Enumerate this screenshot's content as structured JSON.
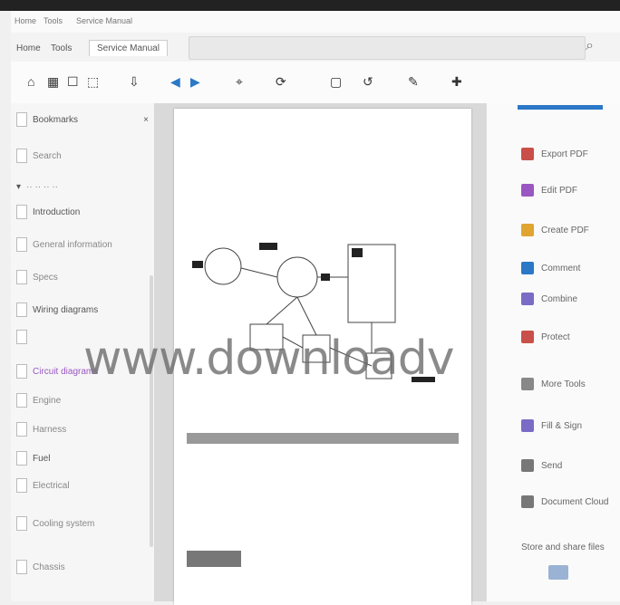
{
  "titlebar": {
    "items": [
      "Home",
      "Tools",
      "Service Manual"
    ],
    "search_placeholder": ""
  },
  "toolbar": {
    "buttons": [
      "⌂",
      "▦",
      "☐",
      "⬚",
      "⇩",
      "◀",
      "▶",
      "⌖",
      "⟳",
      "▢",
      "↺",
      "✎",
      "✚"
    ]
  },
  "sidebar": {
    "header": "Bookmarks",
    "search_label": "Search",
    "items": [
      {
        "label": "Introduction",
        "tone": "dark"
      },
      {
        "label": "General information",
        "tone": "light"
      },
      {
        "label": "Specs",
        "tone": "light"
      },
      {
        "label": "Wiring diagrams",
        "tone": "dark"
      },
      {
        "label": "",
        "tone": "dark"
      },
      {
        "label": "Circuit diagrams",
        "tone": "purple"
      },
      {
        "label": "Engine",
        "tone": "light"
      },
      {
        "label": "Harness",
        "tone": "light"
      },
      {
        "label": "Fuel",
        "tone": "dark"
      },
      {
        "label": "Electrical",
        "tone": "light"
      },
      {
        "label": "Cooling system",
        "tone": "light"
      },
      {
        "label": "Chassis",
        "tone": "light"
      }
    ]
  },
  "document": {
    "page_number": "",
    "heading": "",
    "right_tag": "",
    "paragraph": "",
    "caption": "",
    "links_left": [],
    "links_right": [],
    "section2_label": ""
  },
  "rightpanel": {
    "items": [
      {
        "label": "Export PDF",
        "color": "#c9504a"
      },
      {
        "label": "Edit PDF",
        "color": "#9a57c1"
      },
      {
        "label": "Create PDF",
        "color": "#e0a431"
      },
      {
        "label": "Comment",
        "color": "#2a78c6"
      },
      {
        "label": "Combine",
        "color": "#7a6bc6"
      },
      {
        "label": "Protect",
        "color": "#c9504a"
      },
      {
        "label": "More Tools",
        "color": "#888888"
      },
      {
        "label": "Fill & Sign",
        "color": "#7a6bc6"
      },
      {
        "label": "Send",
        "color": "#777777"
      },
      {
        "label": "Document Cloud",
        "color": "#777777"
      },
      {
        "label": "Store and share files",
        "color": "#666666"
      }
    ]
  },
  "watermark": "www.downloadv",
  "colors": {
    "accent": "#2a78c6",
    "background": "#f0f0f0"
  }
}
